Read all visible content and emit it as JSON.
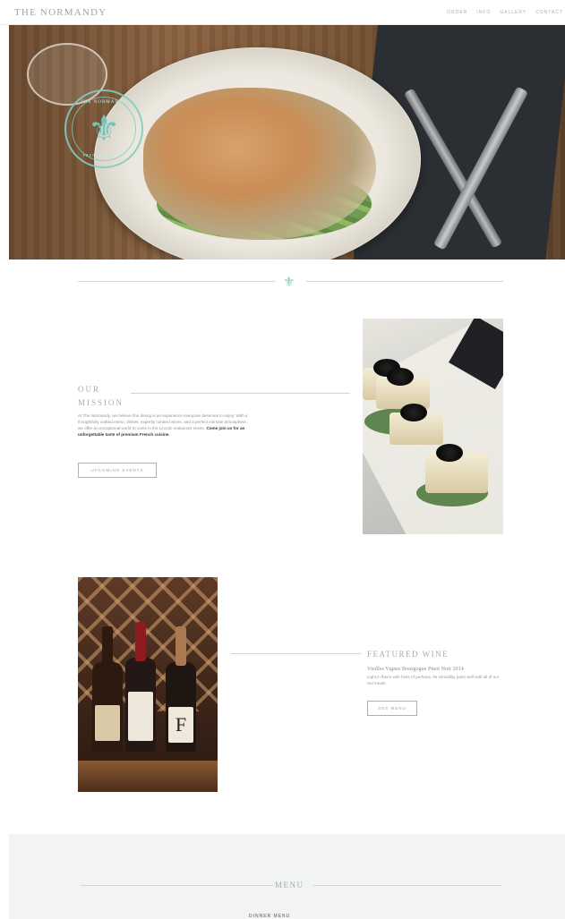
{
  "header": {
    "brand": "THE NORMANDY",
    "nav": [
      "ORDER",
      "INFO",
      "GALLERY",
      "CONTACT"
    ]
  },
  "hero": {
    "seal_top": "THE NORMANDY",
    "seal_bottom": "FRENCH CUISINE",
    "colors": {
      "seal": "#6fc6b6"
    }
  },
  "divider": {
    "icon": "fleur-de-lis-icon",
    "glyph": "⚜"
  },
  "mission": {
    "title_line1": "OUR",
    "title_line2": "MISSION",
    "text": "At The Normandy, we believe fine dining is an experience everyone deserves to enjoy. With a thoughtfully crafted menu, dishes, expertly curated wines, and a perfect intimate atmosphere, we offer an exceptional world to come in the Lincoln restaurant scene.",
    "text_bold": "Come join us for an unforgettable taste of premium French cuisine.",
    "button": "UPCOMING EVENTS"
  },
  "featured_wine": {
    "title": "FEATURED WINE",
    "name": "Vieilles Vignes Bourgogne Pinot Noir 2014",
    "description": "Light in flavor with hints of perfume, its versatility pairs well with all of our red meats.",
    "button": "SEE MENU",
    "bottle_label": "F"
  },
  "menu": {
    "title": "MENU",
    "subtitle": "DINNER MENU"
  },
  "colors": {
    "accent": "#8fc9bd",
    "muted_text": "#9fb0ac",
    "line": "#cfd6d4"
  }
}
